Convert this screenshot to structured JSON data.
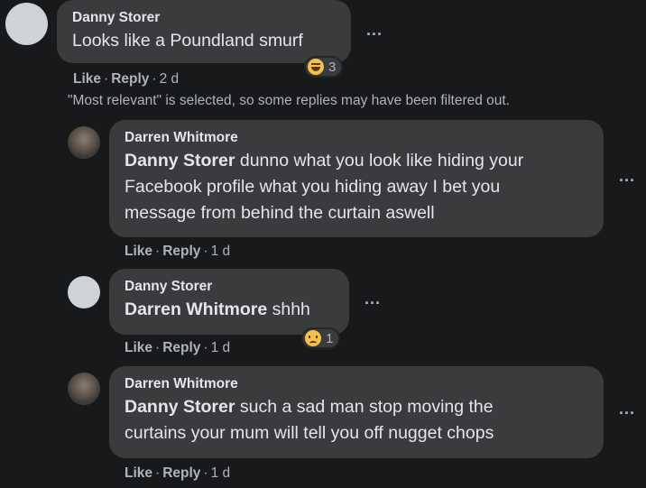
{
  "comments": [
    {
      "author": "Danny Storer",
      "mention": "",
      "lines": [
        "Looks like a Poundland smurf"
      ],
      "like": "Like",
      "reply": "Reply",
      "age": "2 d",
      "reaction_count": "3",
      "reaction": "laugh-emoji"
    },
    {
      "author": "Darren Whitmore",
      "mention": "Danny Storer",
      "lines": [
        " dunno what you look like hiding your",
        "Facebook profile what you hiding away I bet you",
        "message from behind the curtain aswell"
      ],
      "like": "Like",
      "reply": "Reply",
      "age": "1 d"
    },
    {
      "author": "Danny Storer",
      "mention": "Darren Whitmore",
      "lines": [
        " shhh"
      ],
      "like": "Like",
      "reply": "Reply",
      "age": "1 d",
      "reaction_count": "1",
      "reaction": "sad-emoji"
    },
    {
      "author": "Darren Whitmore",
      "mention": "Danny Storer",
      "lines": [
        " such a sad man stop moving the",
        "curtains your mum will tell you off nugget chops"
      ],
      "like": "Like",
      "reply": "Reply",
      "age": "1 d"
    }
  ],
  "filter_notice": "\"Most relevant\" is selected, so some replies may have been filtered out.",
  "more_label": "...",
  "separator": "·"
}
